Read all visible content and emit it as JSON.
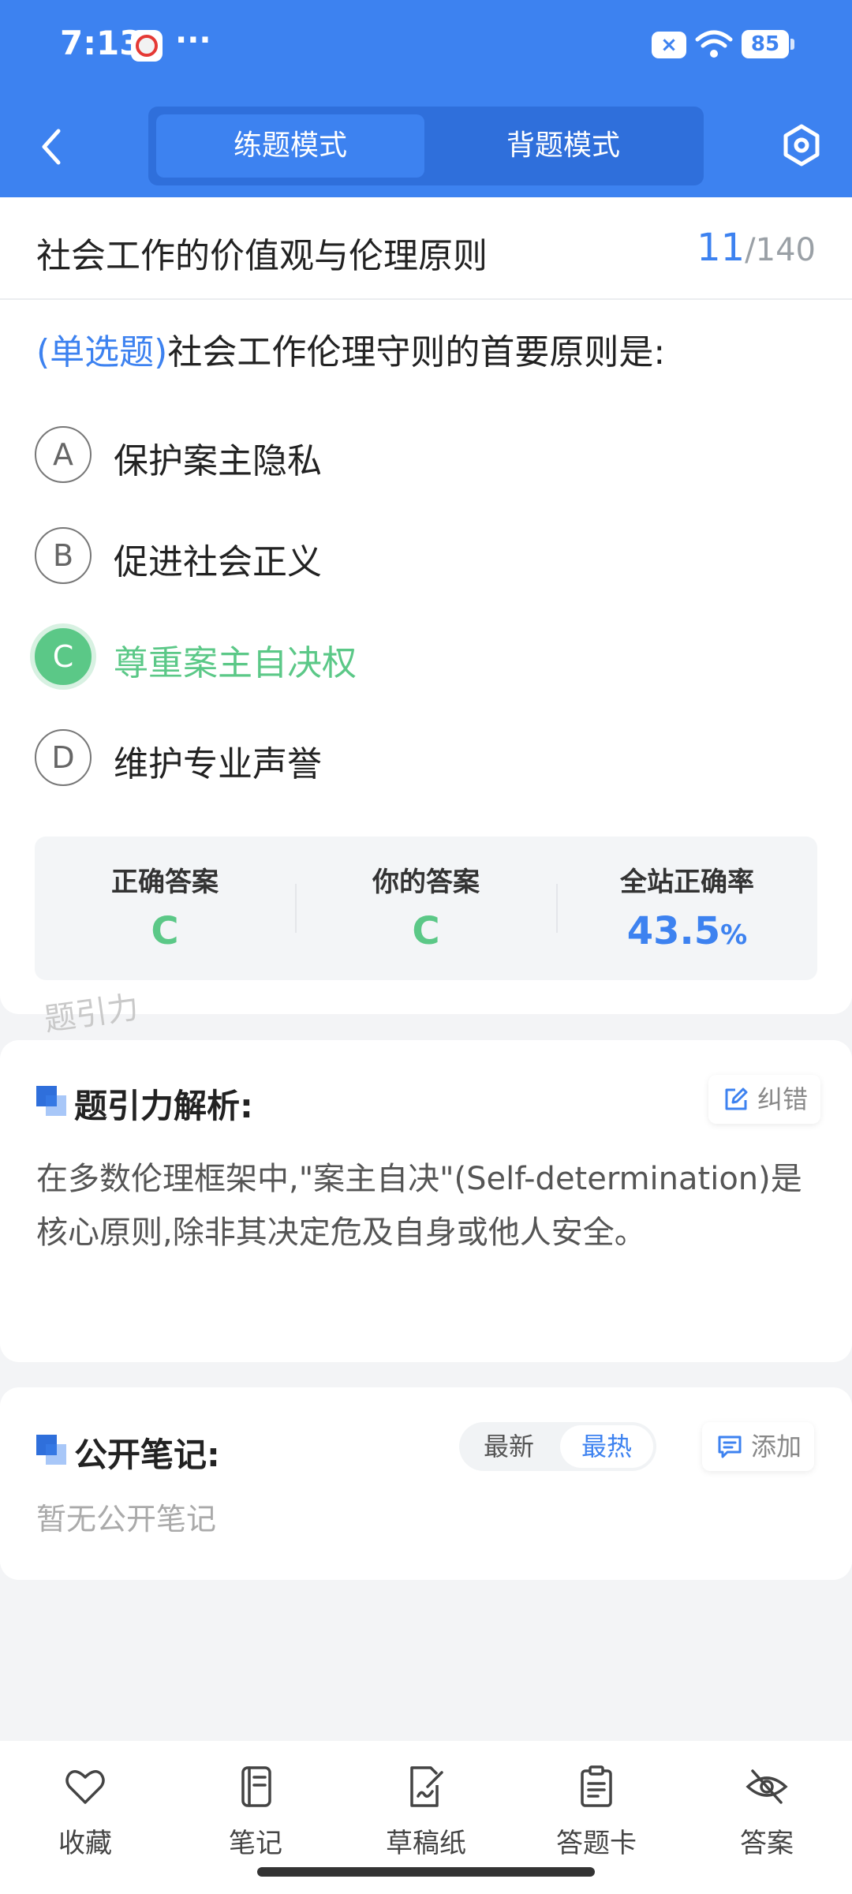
{
  "status_bar": {
    "time": "7:13",
    "more": "···",
    "x_badge": "×",
    "battery": "85"
  },
  "header": {
    "mode_practice": "练题模式",
    "mode_memorize": "背题模式",
    "active_mode": "练题模式",
    "accent": "#3d82f0"
  },
  "question": {
    "chapter": "社会工作的价值观与伦理原则",
    "current": "11",
    "sep": "/",
    "total": "140",
    "type": "(单选题)",
    "text": "社会工作伦理守则的首要原则是:",
    "options": [
      {
        "letter": "A",
        "text": "保护案主隐私"
      },
      {
        "letter": "B",
        "text": "促进社会正义"
      },
      {
        "letter": "C",
        "text": "尊重案主自决权"
      },
      {
        "letter": "D",
        "text": "维护专业声誉"
      }
    ],
    "correct_color": "#5bc887"
  },
  "stats": {
    "correct_label": "正确答案",
    "correct_value": "C",
    "yours_label": "你的答案",
    "yours_value": "C",
    "rate_label": "全站正确率",
    "rate_value": "43.5",
    "rate_unit": "%"
  },
  "watermark": "题引力",
  "analysis": {
    "title": "题引力解析:",
    "report_label": "纠错",
    "text": "在多数伦理框架中,\"案主自决\"(Self-determination)是核心原则,除非其决定危及自身或他人安全。"
  },
  "notes": {
    "title": "公开笔记:",
    "sort_latest": "最新",
    "sort_hot": "最热",
    "add_label": "添加",
    "empty": "暂无公开笔记"
  },
  "bottom_nav": {
    "items": [
      {
        "label": "收藏",
        "icon": "heart-icon"
      },
      {
        "label": "笔记",
        "icon": "notebook-icon"
      },
      {
        "label": "草稿纸",
        "icon": "draft-icon"
      },
      {
        "label": "答题卡",
        "icon": "clipboard-icon"
      },
      {
        "label": "答案",
        "icon": "eye-off-icon"
      }
    ]
  }
}
